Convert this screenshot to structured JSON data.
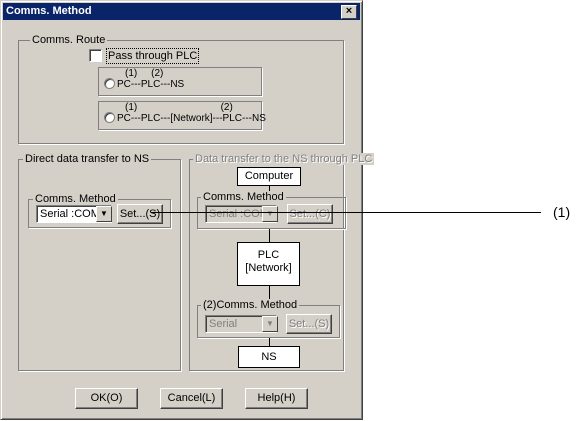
{
  "dialog": {
    "title": "Comms. Method",
    "close_label": "×"
  },
  "comms_route": {
    "label": "Comms. Route",
    "pass_through_label": "Pass through PLC",
    "option1": {
      "top": "(1)     (2)",
      "bottom": "PC---PLC---NS"
    },
    "option2": {
      "top": "(1)                              (2)",
      "bottom": "PC---PLC---[Network]---PLC---NS"
    }
  },
  "direct": {
    "label": "Direct data transfer to NS",
    "method_label": "Comms. Method",
    "select_value": "Serial  :COM1",
    "set_label": "Set...(S)"
  },
  "through_plc": {
    "label": "Data transfer to the NS through PLC",
    "computer_label": "Computer",
    "method_label": "Comms. Method",
    "select_value": "Serial  :COM1",
    "set_label": "Set...(C)",
    "plc_label": "PLC",
    "network_label": "[Network]",
    "method2_label": "(2)Comms. Method",
    "select2_value": "Serial",
    "set2_label": "Set...(S)",
    "ns_label": "NS"
  },
  "footer": {
    "ok_label": "OK(O)",
    "cancel_label": "Cancel(L)",
    "help_label": "Help(H)"
  },
  "callout": {
    "label": "(1)"
  }
}
